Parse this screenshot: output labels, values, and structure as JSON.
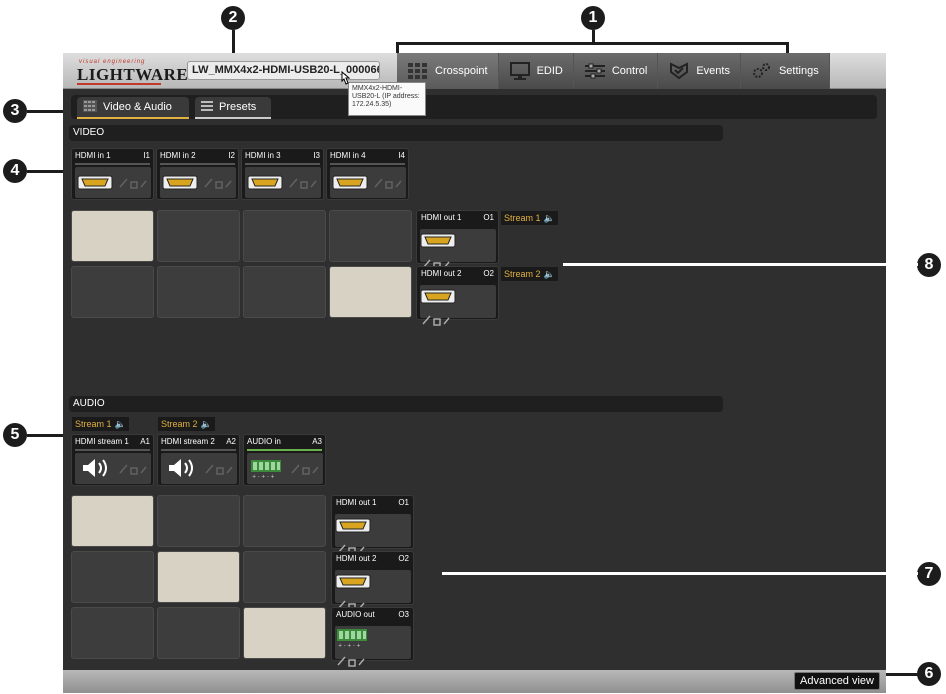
{
  "app": {
    "logo_small": "visual engineering",
    "logo_big": "LIGHTWARE",
    "device_name": "LW_MMX4x2-HDMI-USB20-L_000066...",
    "tooltip": "MMX4x2-HDMI-USB20-L (IP address: 172.24.5.35)",
    "nav": [
      {
        "label": "Crosspoint",
        "icon": "crosspoint-icon"
      },
      {
        "label": "EDID",
        "icon": "monitor-icon"
      },
      {
        "label": "Control",
        "icon": "sliders-icon"
      },
      {
        "label": "Events",
        "icon": "events-icon"
      },
      {
        "label": "Settings",
        "icon": "gears-icon"
      }
    ],
    "tabs": [
      {
        "label": "Video & Audio",
        "icon": "grid-icon"
      },
      {
        "label": "Presets",
        "icon": "list-icon"
      }
    ],
    "video": {
      "section_label": "VIDEO",
      "inputs": [
        {
          "label": "HDMI in 1",
          "id": "I1"
        },
        {
          "label": "HDMI in 2",
          "id": "I2"
        },
        {
          "label": "HDMI in 3",
          "id": "I3"
        },
        {
          "label": "HDMI in 4",
          "id": "I4"
        }
      ],
      "outputs": [
        {
          "label": "HDMI out 1",
          "id": "O1",
          "stream": "Stream 1"
        },
        {
          "label": "HDMI out 2",
          "id": "O2",
          "stream": "Stream 2"
        }
      ]
    },
    "audio": {
      "section_label": "AUDIO",
      "streams": [
        "Stream 1",
        "Stream 2"
      ],
      "inputs": [
        {
          "label": "HDMI stream 1",
          "id": "A1"
        },
        {
          "label": "HDMI stream 2",
          "id": "A2"
        },
        {
          "label": "AUDIO in",
          "id": "A3"
        }
      ],
      "outputs": [
        {
          "label": "HDMI out 1",
          "id": "O1"
        },
        {
          "label": "HDMI out 2",
          "id": "O2"
        },
        {
          "label": "AUDIO out",
          "id": "O3"
        }
      ]
    },
    "advanced_view": "Advanced view"
  },
  "callouts": [
    "1",
    "2",
    "3",
    "4",
    "5",
    "6",
    "7",
    "8"
  ],
  "colors": {
    "active_cell": "#d8d2c4",
    "stream_text": "#e0b040",
    "audio_bar": "#6ab04c"
  }
}
